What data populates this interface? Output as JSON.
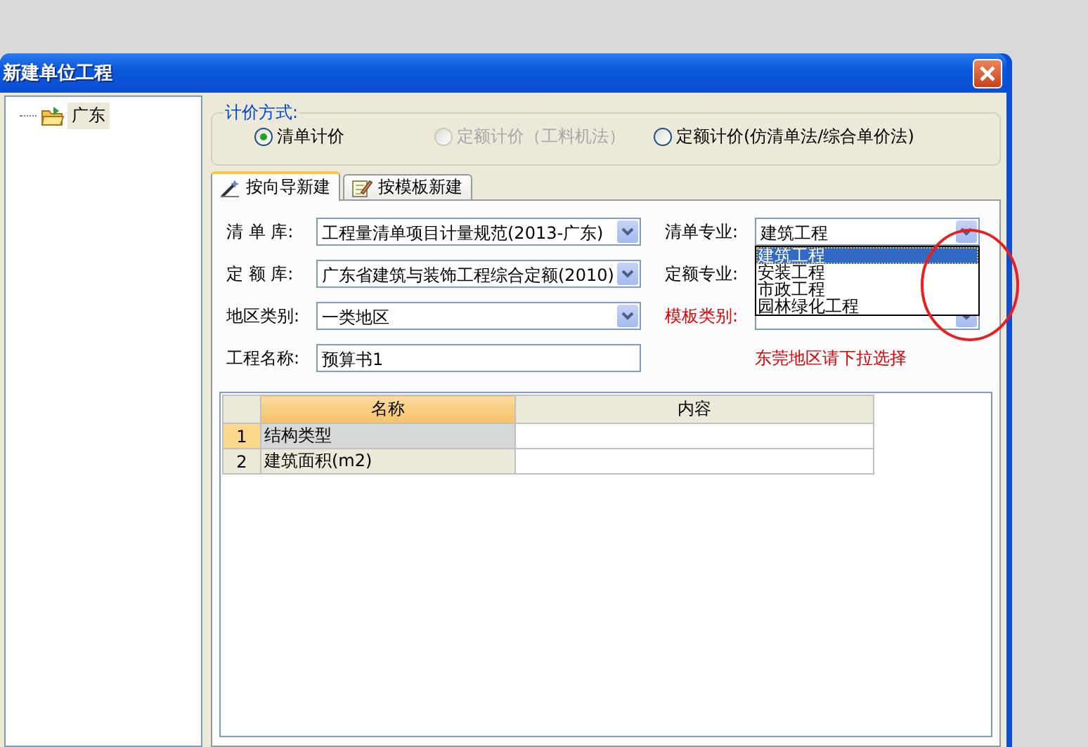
{
  "window": {
    "title": "新建单位工程"
  },
  "tree": {
    "items": [
      {
        "label": "广东",
        "selected": true
      }
    ]
  },
  "pricing_method": {
    "label": "计价方式:",
    "options": [
      {
        "label": "清单计价",
        "selected": true,
        "disabled": false
      },
      {
        "label": "定额计价（工料机法）",
        "selected": false,
        "disabled": true
      },
      {
        "label": "定额计价(仿清单法/综合单价法)",
        "selected": false,
        "disabled": false
      }
    ]
  },
  "tabs": [
    {
      "label": "按向导新建",
      "selected": true,
      "kind": "wizard"
    },
    {
      "label": "按模板新建",
      "selected": false,
      "kind": "template"
    }
  ],
  "form": {
    "left": [
      {
        "label": "清 单 库:",
        "kind": "combo",
        "value": "工程量清单项目计量规范(2013-广东)"
      },
      {
        "label": "定 额 库:",
        "kind": "combo",
        "value": "广东省建筑与装饰工程综合定额(2010)"
      },
      {
        "label": "地区类别:",
        "kind": "combo",
        "value": "一类地区"
      },
      {
        "label": "工程名称:",
        "kind": "text",
        "value": "预算书1"
      }
    ],
    "right": [
      {
        "label": "清单专业:",
        "highlight": false,
        "value": "建筑工程"
      },
      {
        "label": "定额专业:",
        "highlight": false
      },
      {
        "label": "模板类别:",
        "highlight": true
      }
    ],
    "note": "东莞地区请下拉选择",
    "dropdown": {
      "items": [
        {
          "label": "建筑工程",
          "selected": true
        },
        {
          "label": "安装工程",
          "selected": false
        },
        {
          "label": "市政工程",
          "selected": false
        },
        {
          "label": "园林绿化工程",
          "selected": false
        }
      ]
    }
  },
  "grid": {
    "columns": [
      "名称",
      "内容"
    ],
    "rows": [
      {
        "number": "1",
        "name": "结构类型",
        "selected": true
      },
      {
        "number": "2",
        "name": "建筑面积(m2)",
        "selected": false
      }
    ]
  }
}
